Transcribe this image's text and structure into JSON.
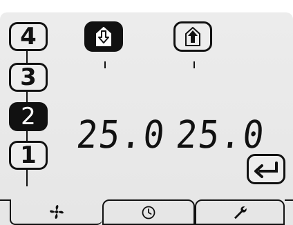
{
  "fan_speeds": {
    "levels": [
      "4",
      "3",
      "2",
      "1"
    ],
    "active": "2"
  },
  "modes": {
    "supply_icon": "arrow-down-into-house-icon",
    "extract_icon": "arrow-up-out-of-house-icon",
    "active": "supply"
  },
  "temperatures": {
    "supply": "25.0",
    "extract": "25.0"
  },
  "enter_icon": "enter-return-icon",
  "tabs": [
    {
      "icon": "fan-icon",
      "active": true
    },
    {
      "icon": "clock-icon",
      "active": false
    },
    {
      "icon": "wrench-icon",
      "active": false
    }
  ]
}
